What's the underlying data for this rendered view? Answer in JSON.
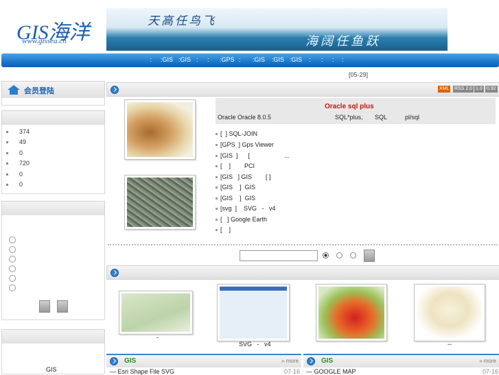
{
  "logo": {
    "mark": "GIS海洋",
    "sub": "www.gissea.cn"
  },
  "banner": {
    "left_calligraphy": "天高任鸟飞",
    "right_calligraphy": "海阔任鱼跃"
  },
  "nav": {
    "items": [
      " : ",
      ":GIS",
      ":GIS",
      ":",
      ":",
      ":GPS",
      ":",
      ":GIS",
      ":GIS",
      ":GIS",
      ":",
      ":",
      ":",
      ":"
    ]
  },
  "date": "[05-29]",
  "left": {
    "login_title": "会员登陆",
    "stats": [
      "374",
      "49",
      "0",
      "720",
      "0",
      "0"
    ],
    "poll_count": 6,
    "bottom_text": "GIS"
  },
  "feeds": {
    "xml": "XML",
    "rss": "RSS 2.0",
    "v1": "1.0",
    "v2": "0.92"
  },
  "article": {
    "title": "Oracle sql plus",
    "line1a": "Oracle Oracle 8.0.5",
    "line1b": "SQL*plus,",
    "line1c": "SQL",
    "line1d": "pl/sql"
  },
  "list": [
    "[  ] SQL-JOIN",
    "[GPS  ] Gps Viewer",
    "[GIS  ]      [                    ...",
    "[    ]        PCI",
    "[GIS   ] GIS        [ ]",
    "[GIS    ]  GIS",
    "[GIS    ]  GIS",
    "[svg  ]    SVG   -   v4",
    "[   ] Google Earth",
    "[    ]"
  ],
  "gallery_captions": [
    "-",
    "SVG   -   v4",
    "",
    "--"
  ],
  "bottom_tabs": [
    {
      "title": "GIS",
      "more": "» more",
      "item": "Esri Shape File SVG",
      "date": "07-16"
    },
    {
      "title": "GIS",
      "more": "» more",
      "item": "GOOGLE MAP",
      "date": "07-16"
    }
  ],
  "colors": {
    "accent": "#1b78cc",
    "title_red": "#cc1111",
    "tab_green": "#2a8a2a"
  }
}
